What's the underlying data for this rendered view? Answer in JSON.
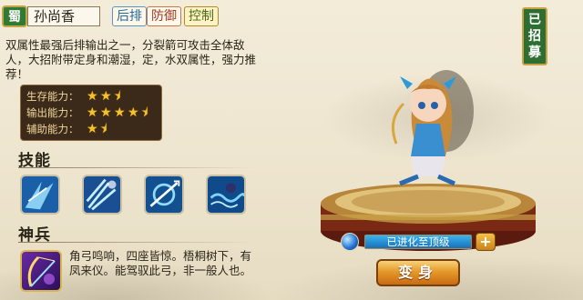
{
  "hero": {
    "faction": "蜀",
    "name": "孙尚香",
    "tags": [
      "后排",
      "防御",
      "控制"
    ],
    "description": "双属性最强后排输出之一，分裂箭可攻击全体敌人，大招附带定身和潮湿，定，水双属性，强力推荐！",
    "recruit_status": "已招募"
  },
  "stats": [
    {
      "label": "生存能力：",
      "stars": 2.5
    },
    {
      "label": "输出能力：",
      "stars": 4.5
    },
    {
      "label": "辅助能力：",
      "stars": 1.5
    }
  ],
  "skills": {
    "title": "技能",
    "icons": [
      "ice-shard-skill-icon",
      "arrow-burst-skill-icon",
      "spin-arrow-skill-icon",
      "water-wave-skill-icon"
    ]
  },
  "weapon": {
    "title": "神兵",
    "description": "角弓鸣响，四座皆惊。梧桐树下，有凤来仪。能驾驭此弓，非一般人也。"
  },
  "evolution": {
    "label": "已进化至顶级",
    "progress": 1.0,
    "plus_label": "+"
  },
  "transform_button": "变身",
  "colors": {
    "accent_green": "#2f7a35",
    "gold": "#c9a447",
    "button_orange": "#e59a2a"
  }
}
